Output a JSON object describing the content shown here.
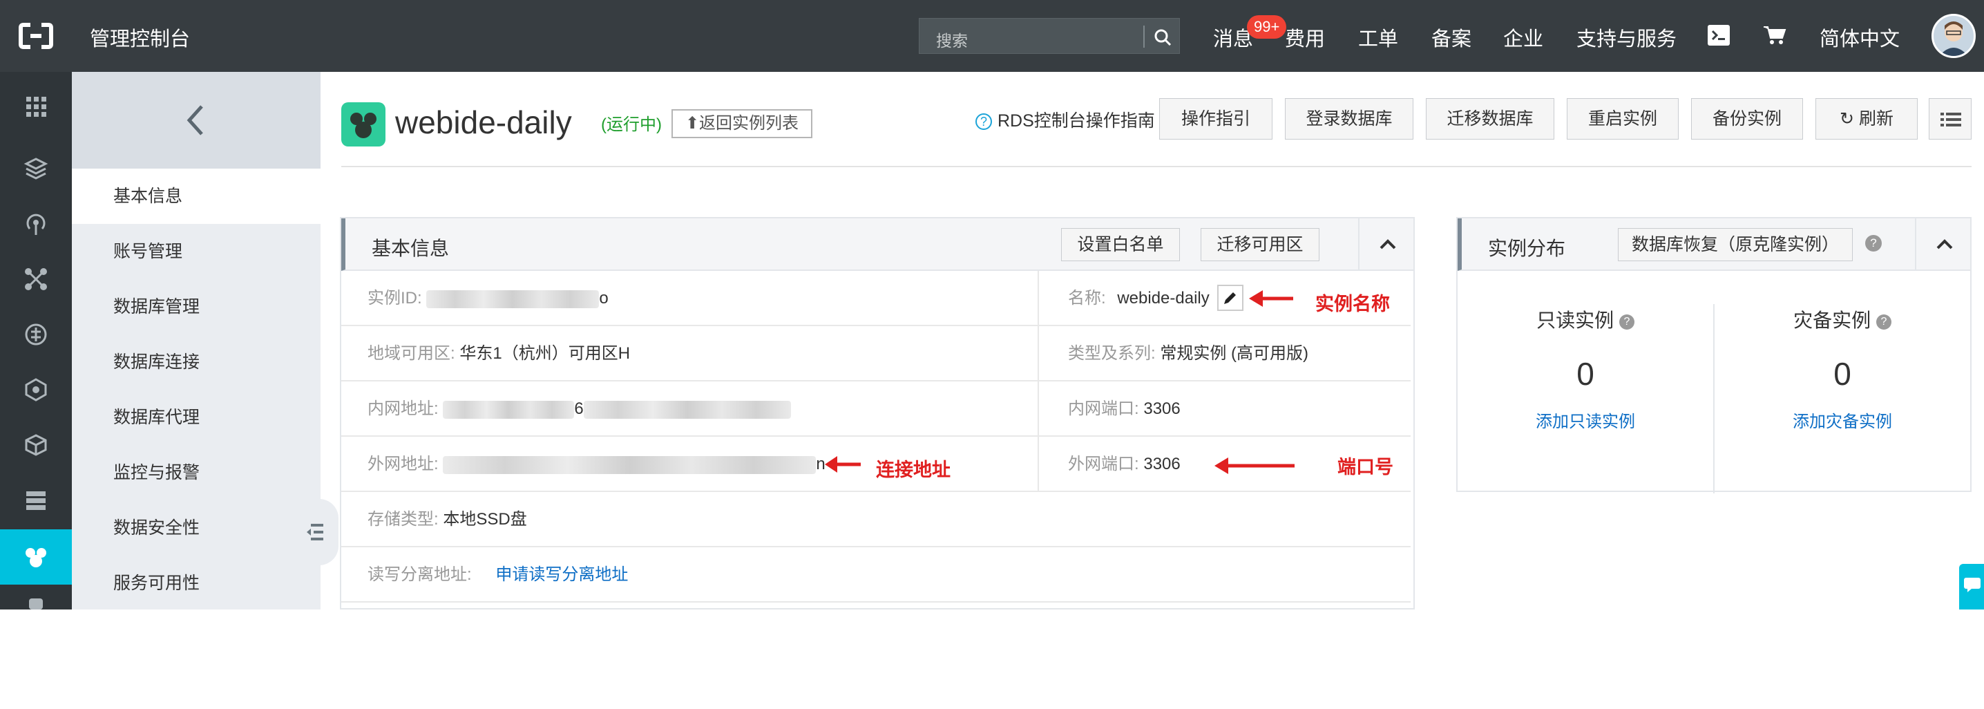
{
  "topbar": {
    "brand": "管理控制台",
    "search_placeholder": "搜索",
    "nav": {
      "messages": "消息",
      "messages_badge": "99+",
      "billing": "费用",
      "tickets": "工单",
      "icp": "备案",
      "enterprise": "企业",
      "support": "支持与服务",
      "language": "简体中文"
    }
  },
  "sidebar": {
    "items": [
      "基本信息",
      "账号管理",
      "数据库管理",
      "数据库连接",
      "数据库代理",
      "监控与报警",
      "数据安全性",
      "服务可用性"
    ]
  },
  "header": {
    "instance_name": "webide-daily",
    "status": "(运行中)",
    "back_to_list": "返回实例列表",
    "guide": "RDS控制台操作指南",
    "buttons": [
      "操作指引",
      "登录数据库",
      "迁移数据库",
      "重启实例",
      "备份实例",
      "刷新"
    ]
  },
  "basic_info": {
    "title": "基本信息",
    "whitelist_btn": "设置白名单",
    "migrate_zone_btn": "迁移可用区",
    "rows": {
      "instance_id_label": "实例ID:",
      "instance_id_tail": "o",
      "name_label": "名称:",
      "name_value": "webide-daily",
      "region_label": "地域可用区:",
      "region_value": "华东1（杭州）可用区H",
      "type_label": "类型及系列:",
      "type_value": "常规实例 (高可用版)",
      "intranet_addr_label": "内网地址:",
      "intranet_addr_mid": "6",
      "intranet_port_label": "内网端口:",
      "intranet_port_value": "3306",
      "internet_addr_label": "外网地址:",
      "internet_addr_tail": "n",
      "internet_port_label": "外网端口:",
      "internet_port_value": "3306",
      "storage_label": "存储类型:",
      "storage_value": "本地SSD盘",
      "rw_split_label": "读写分离地址:",
      "rw_split_link": "申请读写分离地址"
    }
  },
  "annotations": {
    "instance_name": "实例名称",
    "connection_address": "连接地址",
    "port": "端口号"
  },
  "distribution": {
    "title": "实例分布",
    "restore_btn": "数据库恢复（原克隆实例）",
    "readonly_label": "只读实例",
    "readonly_count": "0",
    "readonly_link": "添加只读实例",
    "disaster_label": "灾备实例",
    "disaster_count": "0",
    "disaster_link": "添加灾备实例"
  },
  "colors": {
    "topbar": "#373d41",
    "rail": "#2f3539",
    "accent": "#00c1de",
    "status_green": "#1e9e2c",
    "annotation_red": "#e02020",
    "link_blue": "#0f6fc6"
  }
}
